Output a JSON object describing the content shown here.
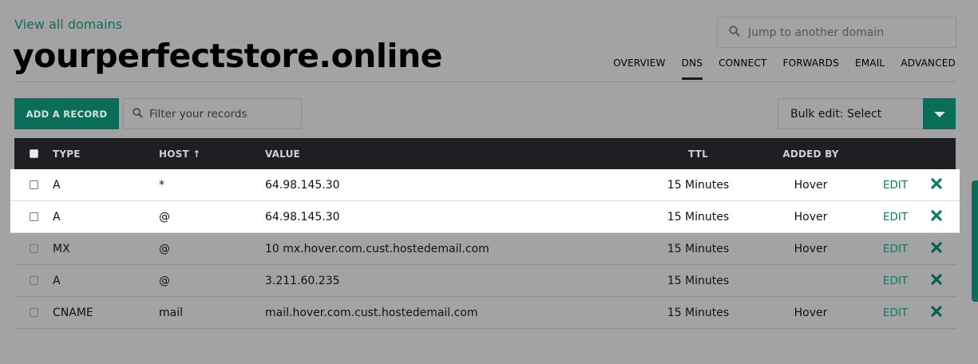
{
  "header": {
    "view_all_link": "View all domains",
    "domain_title": "yourperfectstore.online",
    "search_placeholder": "Jump to another domain",
    "tabs": [
      {
        "label": "OVERVIEW"
      },
      {
        "label": "DNS",
        "active": true
      },
      {
        "label": "CONNECT"
      },
      {
        "label": "FORWARDS"
      },
      {
        "label": "EMAIL"
      },
      {
        "label": "ADVANCED"
      }
    ]
  },
  "toolbar": {
    "add_record_label": "ADD A RECORD",
    "filter_placeholder": "Filter your records",
    "bulk_edit_label": "Bulk edit: Select"
  },
  "table": {
    "columns": {
      "type": "TYPE",
      "host": "HOST",
      "host_sort_indicator": "↑",
      "value": "VALUE",
      "ttl": "TTL",
      "added_by": "ADDED BY"
    },
    "edit_label": "EDIT",
    "rows": [
      {
        "type": "A",
        "host": "*",
        "value": "64.98.145.30",
        "ttl": "15 Minutes",
        "added_by": "Hover",
        "highlighted": true
      },
      {
        "type": "A",
        "host": "@",
        "value": "64.98.145.30",
        "ttl": "15 Minutes",
        "added_by": "Hover",
        "highlighted": true
      },
      {
        "type": "MX",
        "host": "@",
        "value": "10 mx.hover.com.cust.hostedemail.com",
        "ttl": "15 Minutes",
        "added_by": "Hover",
        "highlighted": false
      },
      {
        "type": "A",
        "host": "@",
        "value": "3.211.60.235",
        "ttl": "15 Minutes",
        "added_by": "",
        "highlighted": false
      },
      {
        "type": "CNAME",
        "host": "mail",
        "value": "mail.hover.com.cust.hostedemail.com",
        "ttl": "15 Minutes",
        "added_by": "Hover",
        "highlighted": false
      }
    ]
  },
  "colors": {
    "brand_green": "#0b6e5b",
    "edit_green": "#0d7a63",
    "delete_green": "#0d7a63",
    "overlay_gray": "#a3a3a3",
    "header_dark": "#1e1f22"
  },
  "icons": {
    "search": "search-icon",
    "filter": "search-icon",
    "caret": "chevron-down-icon",
    "delete": "close-icon"
  }
}
